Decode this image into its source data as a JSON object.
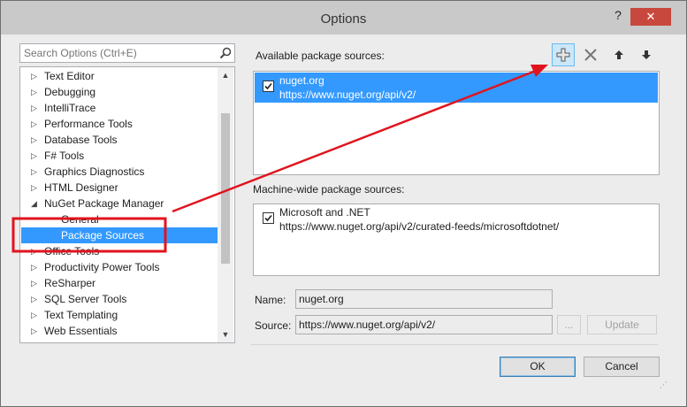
{
  "window": {
    "title": "Options",
    "help_glyph": "?",
    "close_glyph": "✕"
  },
  "search": {
    "placeholder": "Search Options (Ctrl+E)"
  },
  "tree": {
    "items": [
      {
        "label": "Text Editor"
      },
      {
        "label": "Debugging"
      },
      {
        "label": "IntelliTrace"
      },
      {
        "label": "Performance Tools"
      },
      {
        "label": "Database Tools"
      },
      {
        "label": "F# Tools"
      },
      {
        "label": "Graphics Diagnostics"
      },
      {
        "label": "HTML Designer"
      },
      {
        "label": "NuGet Package Manager"
      },
      {
        "label": "General"
      },
      {
        "label": "Package Sources"
      },
      {
        "label": "Office Tools"
      },
      {
        "label": "Productivity Power Tools"
      },
      {
        "label": "ReSharper"
      },
      {
        "label": "SQL Server Tools"
      },
      {
        "label": "Text Templating"
      },
      {
        "label": "Web Essentials"
      }
    ]
  },
  "available": {
    "label": "Available package sources:",
    "sources": [
      {
        "name": "nuget.org",
        "url": "https://www.nuget.org/api/v2/"
      }
    ]
  },
  "machine_wide": {
    "label": "Machine-wide package sources:",
    "sources": [
      {
        "name": "Microsoft and .NET",
        "url": "https://www.nuget.org/api/v2/curated-feeds/microsoftdotnet/"
      }
    ]
  },
  "form": {
    "name_label": "Name:",
    "name_value": "nuget.org",
    "source_label": "Source:",
    "source_value": "https://www.nuget.org/api/v2/",
    "browse_label": "...",
    "update_label": "Update"
  },
  "buttons": {
    "ok": "OK",
    "cancel": "Cancel"
  },
  "colors": {
    "selection": "#3399ff",
    "annotation": "#e0141e",
    "add_button_bg": "#cbe7f8"
  }
}
